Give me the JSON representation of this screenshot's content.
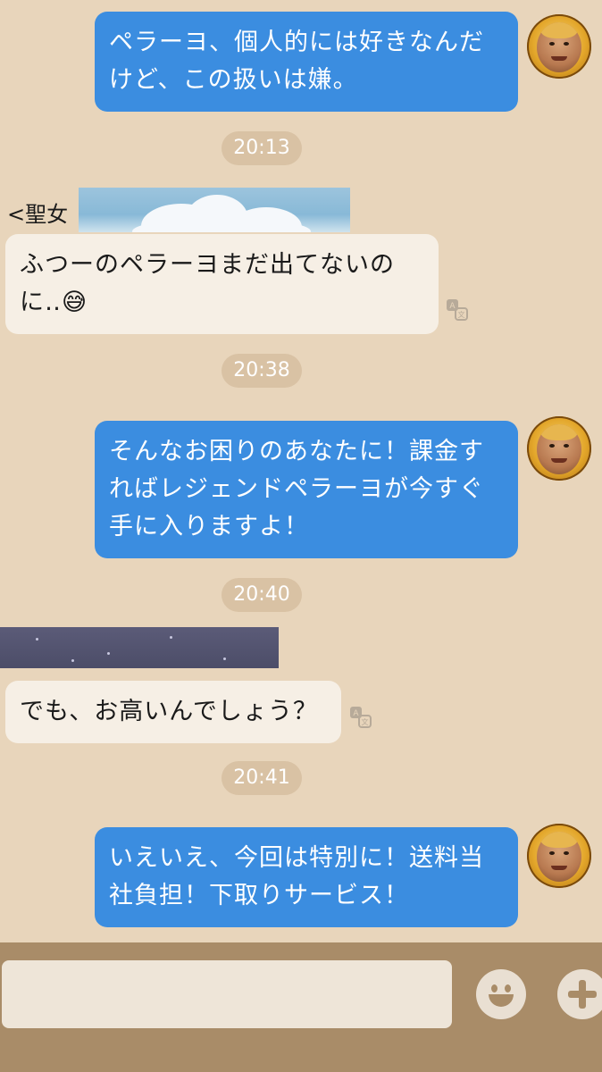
{
  "messages": {
    "m1": {
      "text": "ペラーヨ、個人的には好きなんだけど、この扱いは嫌。"
    },
    "time1": "20:13",
    "sender_name": "<聖女",
    "m2": {
      "text": "ふつーのペラーヨまだ出てないのに‥😅"
    },
    "time2": "20:38",
    "m3": {
      "text": "そんなお困りのあなたに！課金すればレジェンドペラーヨが今すぐ手に入りますよ！"
    },
    "time3": "20:40",
    "m4": {
      "text": "でも、お高いんでしょう？"
    },
    "time4": "20:41",
    "m5": {
      "text": "いえいえ、今回は特別に！送料当社負担！下取りサービス！"
    }
  },
  "input": {
    "value": "",
    "placeholder": ""
  },
  "icons": {
    "avatar": "avatar-icon",
    "translate": "translate-icon",
    "emoji": "emoji-icon",
    "plus": "plus-icon"
  },
  "colors": {
    "background": "#e8d5bb",
    "outgoing_bubble": "#3b8de0",
    "incoming_bubble": "#f6efe5",
    "time_pill": "#d9c2a4",
    "input_bar": "#a98c68"
  }
}
